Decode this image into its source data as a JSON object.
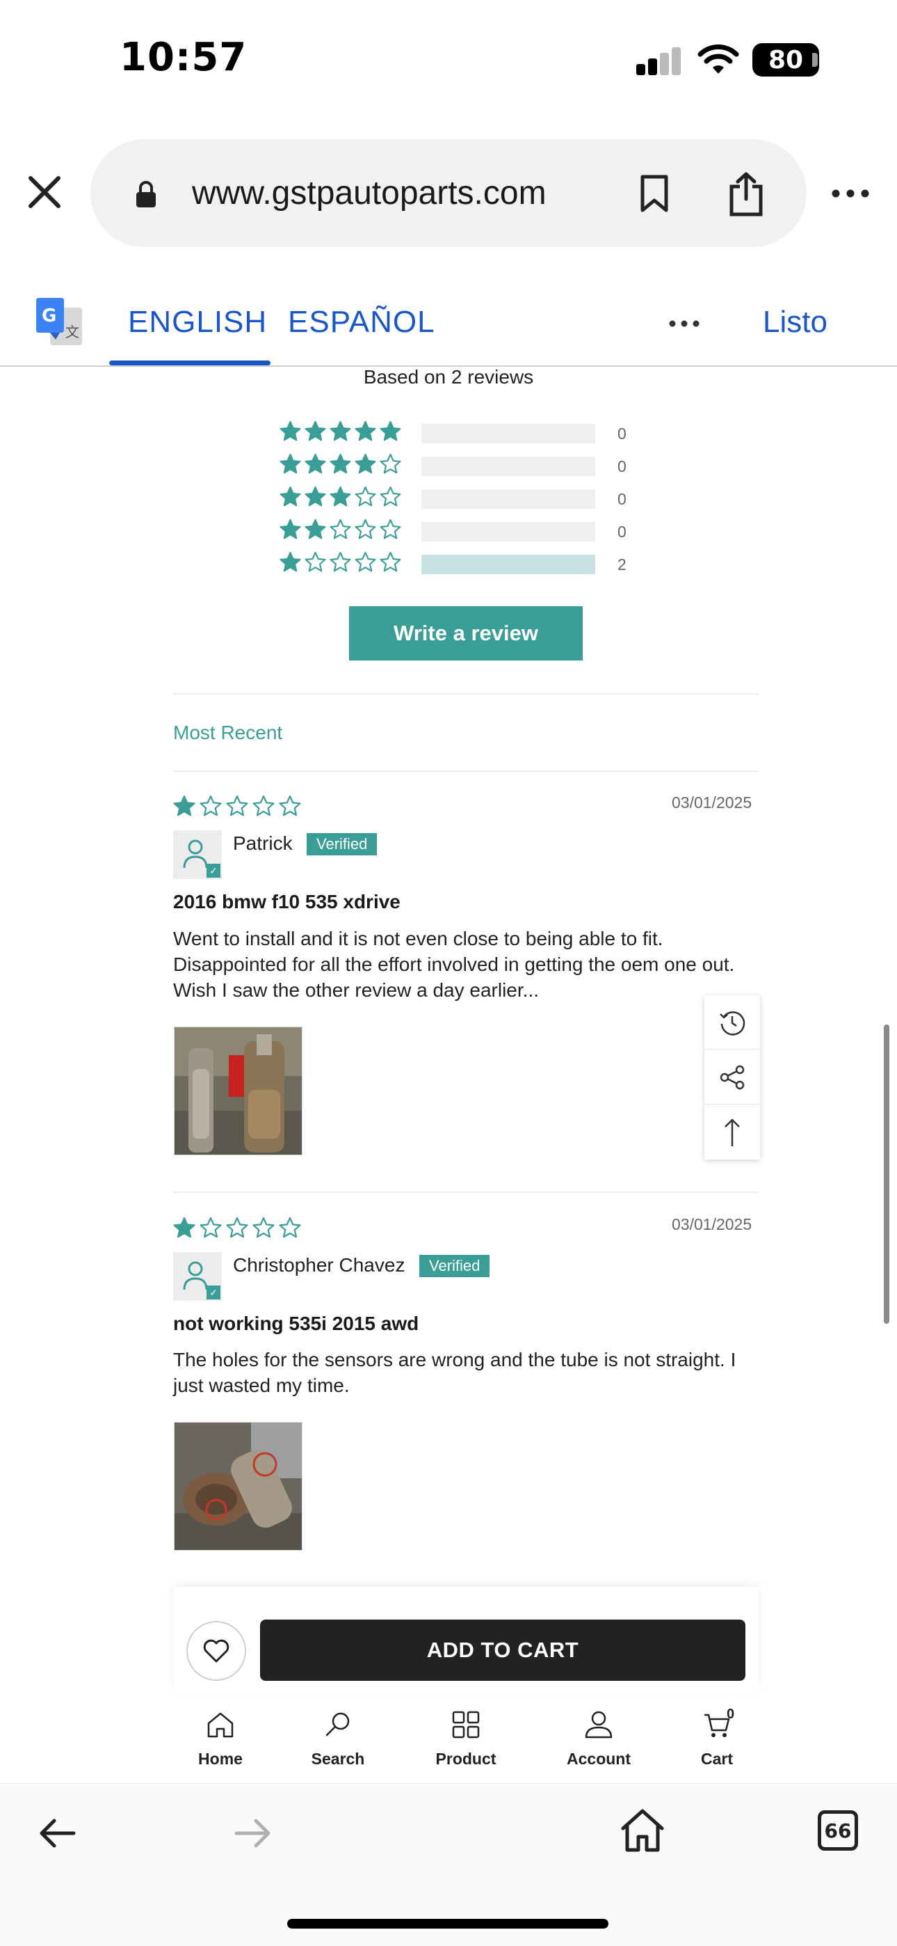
{
  "status": {
    "time": "10:57",
    "battery": "80"
  },
  "browser": {
    "url": "www.gstpautoparts.com"
  },
  "translate": {
    "tab_english": "ENGLISH",
    "tab_spanish": "ESPAÑOL",
    "done": "Listo"
  },
  "summary": {
    "based_on": "Based on 2 reviews",
    "distribution": [
      {
        "stars": 5,
        "count": "0",
        "fraction": 0
      },
      {
        "stars": 4,
        "count": "0",
        "fraction": 0
      },
      {
        "stars": 3,
        "count": "0",
        "fraction": 0
      },
      {
        "stars": 2,
        "count": "0",
        "fraction": 0
      },
      {
        "stars": 1,
        "count": "2",
        "fraction": 1
      }
    ],
    "write_review": "Write a review",
    "sort": "Most Recent"
  },
  "reviews": [
    {
      "rating": 1,
      "date": "03/01/2025",
      "name": "Patrick",
      "verified": "Verified",
      "title": "2016 bmw f10 535 xdrive",
      "body": "Went to install and it is not even close to being able to fit. Disappointed for all the effort involved in getting the oem one out. Wish I saw the other review a day earlier..."
    },
    {
      "rating": 1,
      "date": "03/01/2025",
      "name": "Christopher Chavez",
      "verified": "Verified",
      "title": "not working 535i 2015 awd",
      "body": "The holes for the sensors are wrong and the tube is not straight. I just wasted my time."
    }
  ],
  "cart": {
    "add_to_cart": "ADD TO CART"
  },
  "bottom_nav": {
    "home": "Home",
    "search": "Search",
    "product": "Product",
    "account": "Account",
    "cart": "Cart",
    "cart_count": "0"
  },
  "tabs_count": "66",
  "colors": {
    "accent": "#3a9e96",
    "link": "#1a56c8",
    "button_dark": "#222222"
  }
}
